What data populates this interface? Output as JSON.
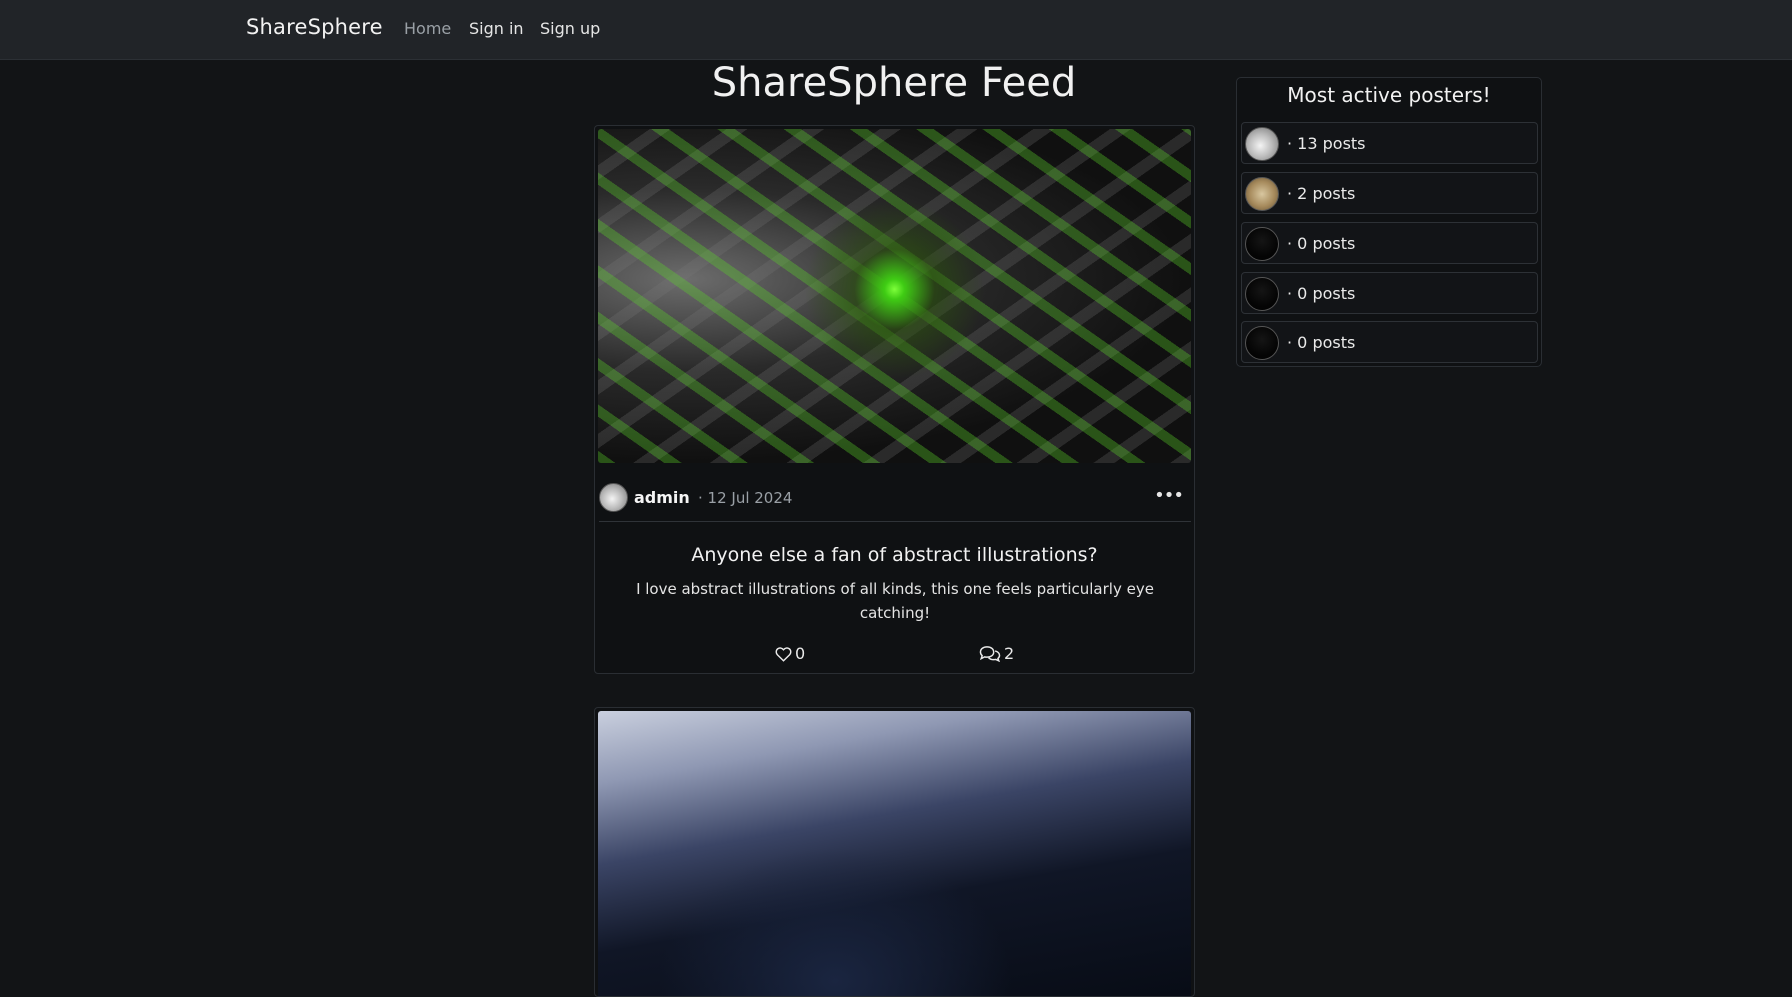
{
  "navbar": {
    "brand": "ShareSphere",
    "links": [
      {
        "label": "Home",
        "active": true
      },
      {
        "label": "Sign in",
        "active": false
      },
      {
        "label": "Sign up",
        "active": false
      }
    ]
  },
  "feed": {
    "title": "ShareSphere Feed",
    "posts": [
      {
        "author": "admin",
        "date": "· 12 Jul 2024",
        "title": "Anyone else a fan of abstract illustrations?",
        "body": "I love abstract illustrations of all kinds, this one feels particularly eye catching!",
        "likes": "0",
        "comments": "2",
        "more_icon": "•••"
      }
    ]
  },
  "sidebar": {
    "title": "Most active posters!",
    "posters": [
      {
        "count": "· 13 posts"
      },
      {
        "count": "· 2 posts"
      },
      {
        "count": "· 0 posts"
      },
      {
        "count": "· 0 posts"
      },
      {
        "count": "· 0 posts"
      }
    ]
  },
  "icons": {
    "heart": "heart-outline-icon",
    "comment": "comment-bubbles-icon",
    "more": "ellipsis-icon"
  },
  "colors": {
    "background": "#121416",
    "navbar": "#212428",
    "card": "#0f1113",
    "accent_green": "#5cd627"
  }
}
